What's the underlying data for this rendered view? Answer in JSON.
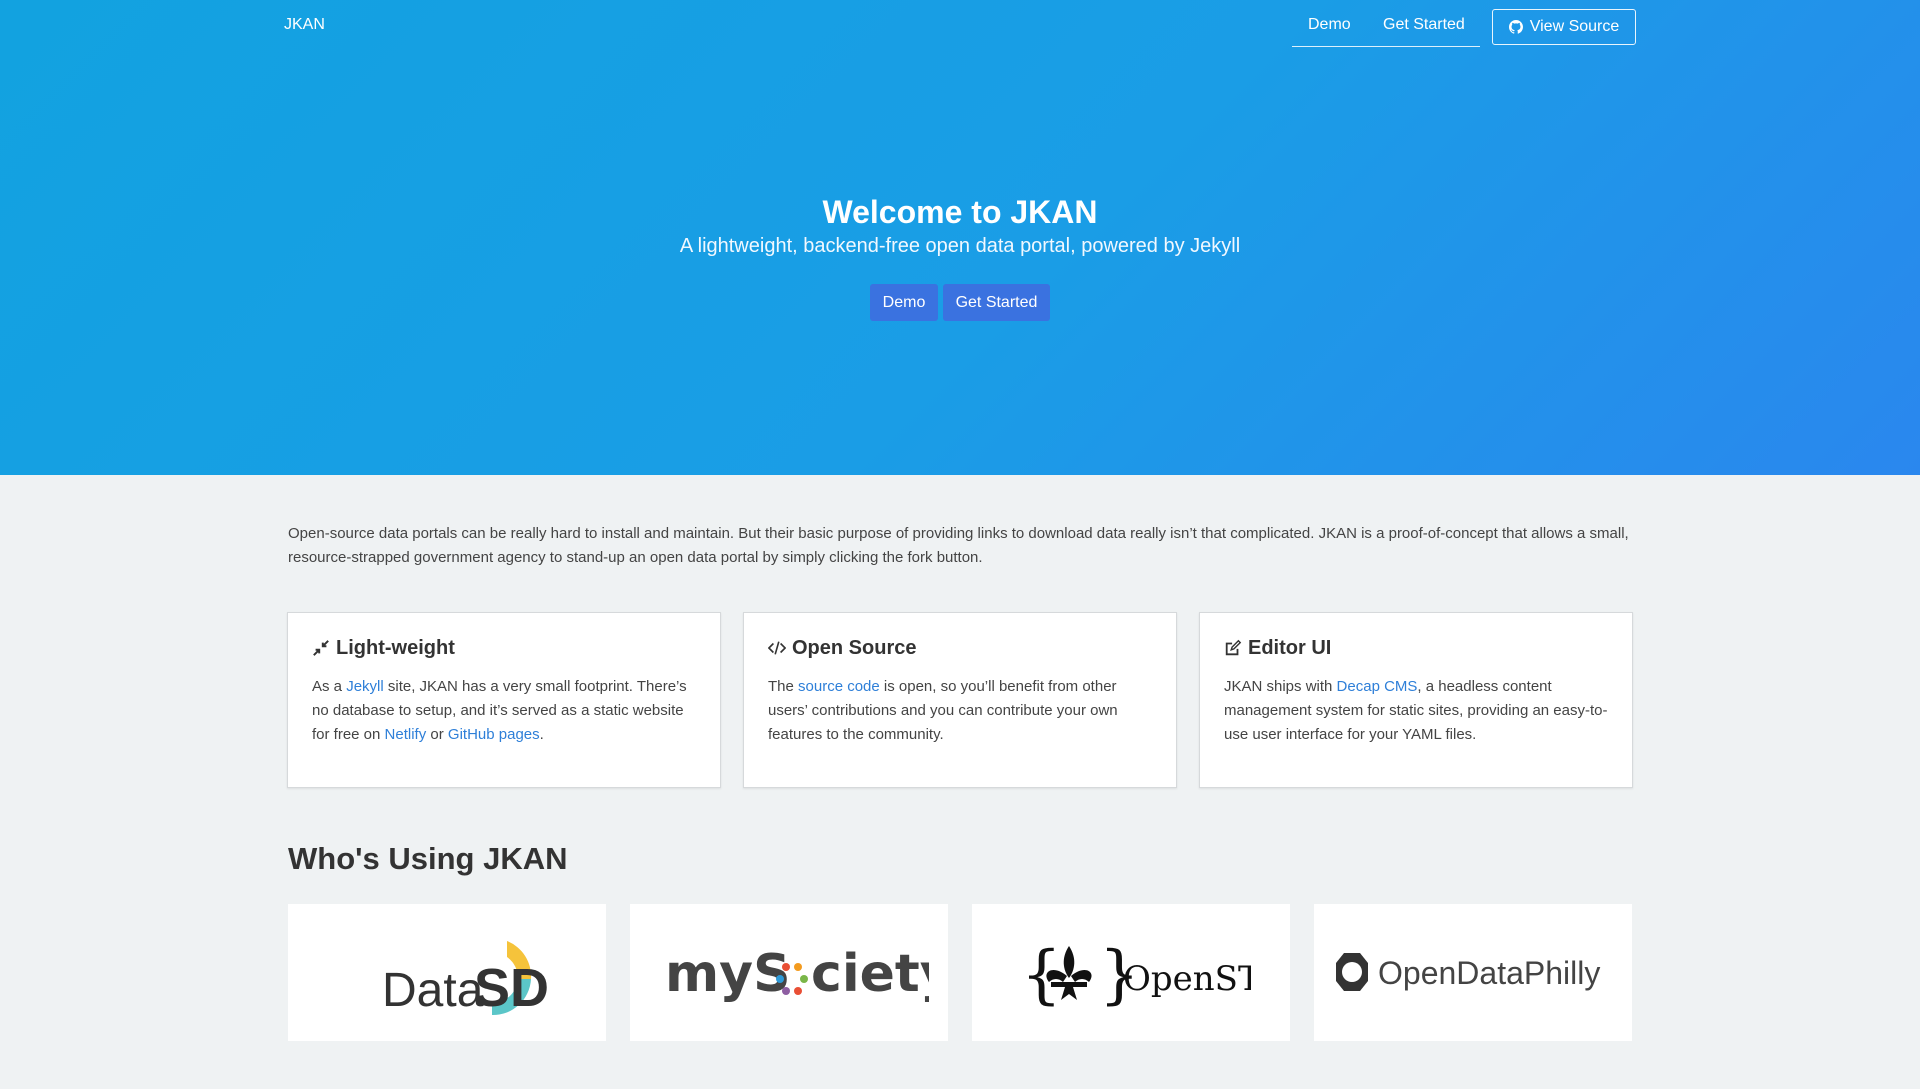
{
  "navbar": {
    "brand": "JKAN",
    "links": [
      "Demo",
      "Get Started"
    ],
    "view_source": "View Source"
  },
  "hero": {
    "title": "Welcome to JKAN",
    "subtitle": "A lightweight, backend-free open data portal, powered by Jekyll",
    "buttons": [
      "Demo",
      "Get Started"
    ]
  },
  "intro": "Open-source data portals can be really hard to install and maintain. But their basic purpose of providing links to download data really isn’t that complicated. JKAN is a proof-of-concept that allows a small, resource-strapped government agency to stand-up an open data portal by simply clicking the fork button.",
  "features": [
    {
      "title": "Light-weight",
      "icon": "compress-icon",
      "text": [
        "As a ",
        "Jekyll",
        " site, JKAN has a very small footprint. There’s no database to setup, and it’s served as a static website for free on ",
        "Netlify",
        " or ",
        "GitHub pages",
        "."
      ]
    },
    {
      "title": "Open Source",
      "icon": "code-icon",
      "text": [
        "The ",
        "source code",
        " is open, so you’ll benefit from other users’ contributions and you can contribute your own features to the community."
      ]
    },
    {
      "title": "Editor UI",
      "icon": "edit-icon",
      "text": [
        "JKAN ships with ",
        "Decap CMS",
        ", a headless content management system for static sites, providing an easy-to-use user interface for your YAML files."
      ]
    }
  ],
  "using": {
    "title": "Who's Using JKAN",
    "logos": [
      {
        "name": "Data SD",
        "parts": [
          "Data",
          "SD"
        ]
      },
      {
        "name": "mySociety",
        "parts": [
          "myS",
          "ciety"
        ]
      },
      {
        "name": "OpenSTL",
        "parts": [
          "OpenSTL"
        ]
      },
      {
        "name": "OpenDataPhilly",
        "parts": [
          "OpenDataPhilly"
        ]
      }
    ]
  },
  "colors": {
    "hero_start": "#12a2e0",
    "hero_end": "#2a87ee",
    "button": "#3a72e0",
    "link": "#2e7fd8",
    "page_bg": "#eff2f3"
  }
}
